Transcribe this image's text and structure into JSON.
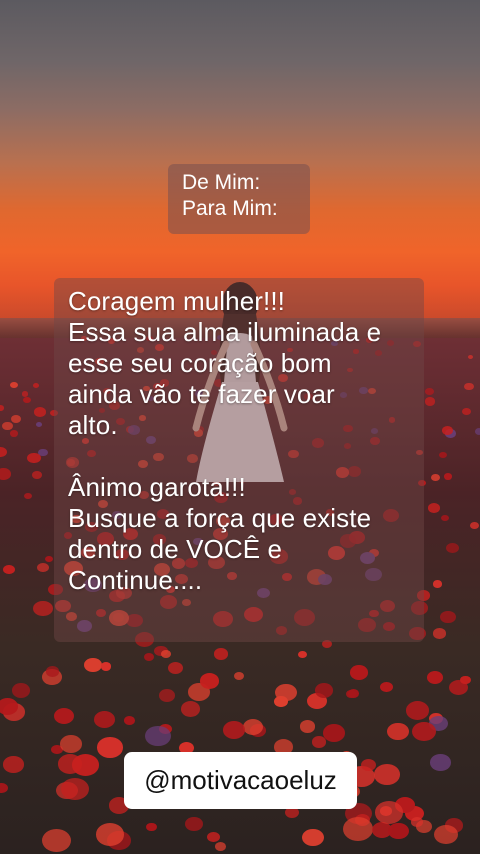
{
  "header_note": {
    "line1": "De Mim:",
    "line2": "Para Mim:"
  },
  "message": {
    "lines_p1": [
      "Coragem mulher!!!",
      "Essa sua alma iluminada e",
      "esse seu coração bom",
      "ainda vão te fazer voar",
      "alto."
    ],
    "lines_p2": [
      "Ânimo garota!!!",
      "Busque a força que existe",
      "dentro de VOCÊ e",
      "Continue...."
    ]
  },
  "handle": "@motivacaoeluz",
  "colors": {
    "sky_top": "#5c5a60",
    "sunset": "#f0642a",
    "poppy_red": "#c8201f",
    "handle_bg": "#ffffff"
  }
}
